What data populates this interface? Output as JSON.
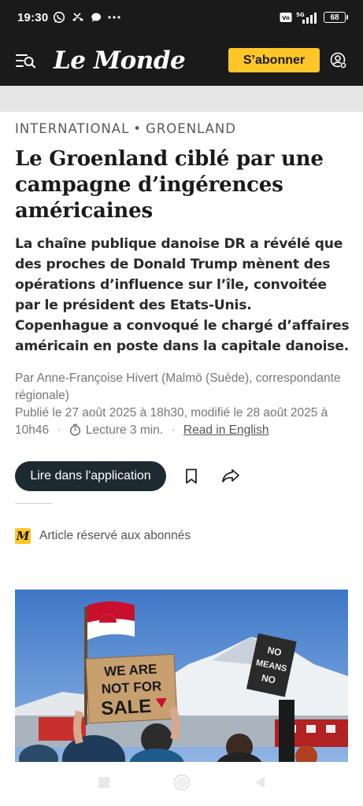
{
  "status_bar": {
    "time": "19:30",
    "left_icons": [
      "whatsapp-icon",
      "missed-call-icon",
      "chat-bubble-icon",
      "more-dots-icon"
    ],
    "network": "5G",
    "volte": "VoLTE",
    "battery": "68"
  },
  "header": {
    "logo": "Le Monde",
    "subscribe_label": "S’abonner",
    "accent_color": "#ffc629"
  },
  "article": {
    "kicker_section": "INTERNATIONAL",
    "kicker_separator": "•",
    "kicker_topic": "GROENLAND",
    "title": "Le Groenland ciblé par une campagne d’ingérences américaines",
    "standfirst": "La chaîne publique danoise DR a révélé que des proches de Donald Trump mènent des opérations d’influence sur l’île, convoitée par le président des Etats-Unis. Copenhague a convoqué le chargé d’affaires américain en poste dans la capitale danoise.",
    "byline": "Par Anne-Françoise Hivert (Malmö (Suède), correspondante régionale)",
    "published": "Publié le 27 août 2025 à 18h30, modifié le 28 août 2025 à 10h46",
    "meta_separator": "·",
    "reading_time": "Lecture 3 min.",
    "read_in_english": "Read in English",
    "open_app_label": "Lire dans l'application",
    "subscriber_badge": "M",
    "subscriber_notice": "Article réservé aux abonnés"
  },
  "photo": {
    "sign_main": [
      "WE ARE",
      "NOT FOR",
      "SALE"
    ],
    "sign_side": [
      "NO",
      "MEANS",
      "NO"
    ]
  }
}
